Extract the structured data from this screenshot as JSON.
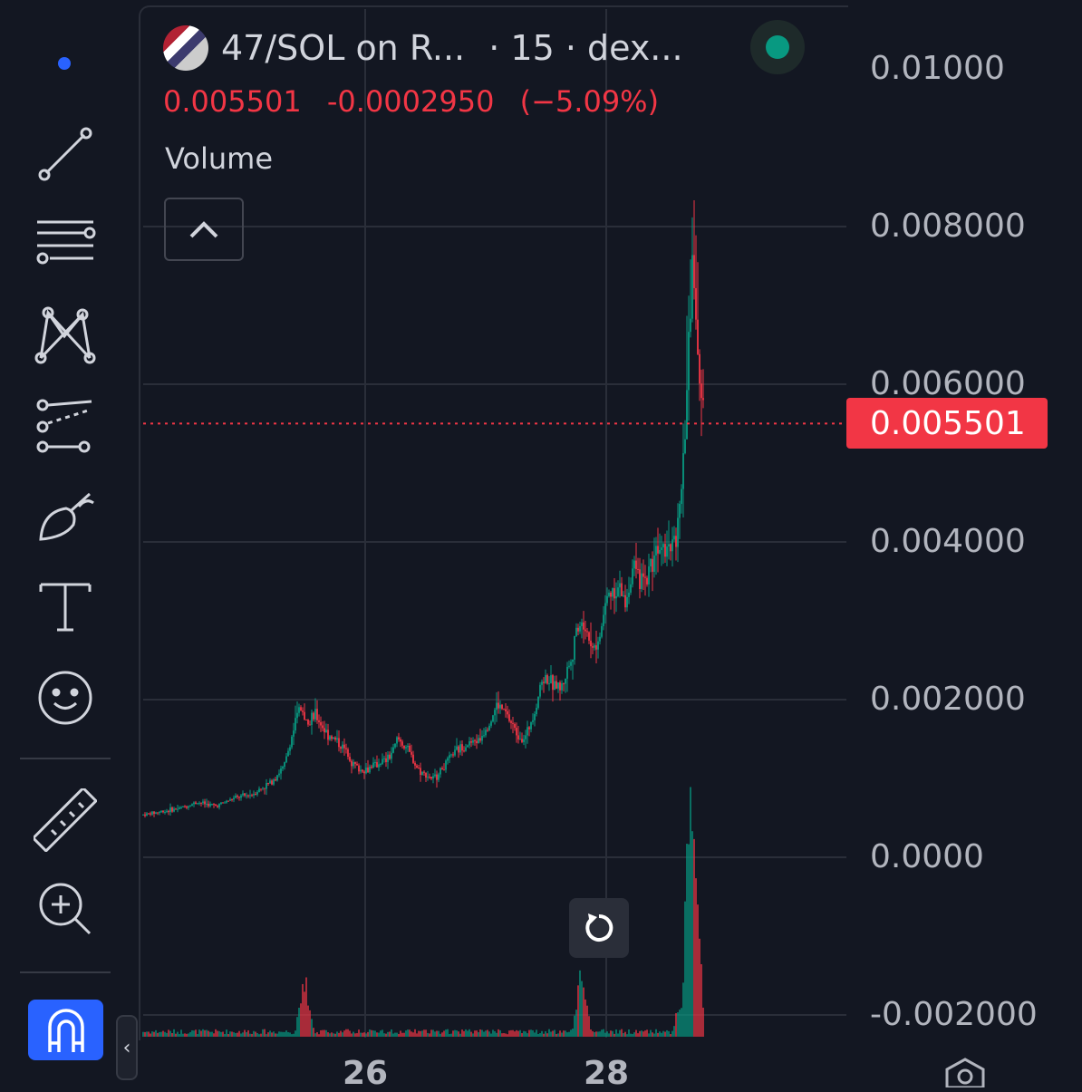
{
  "header": {
    "symbol": "47/SOL on R...",
    "interval": "· 15 · dex...",
    "last_price": "0.005501",
    "change": "-0.0002950",
    "change_pct": "(−5.09%)"
  },
  "indicator": {
    "volume_label": "Volume"
  },
  "price_axis": {
    "labels": [
      "0.01000",
      "0.008000",
      "0.006000",
      "0.004000",
      "0.002000",
      "0.0000",
      "-0.002000"
    ],
    "current_price_tag": "0.005501"
  },
  "time_axis": {
    "labels": [
      "26",
      "28"
    ]
  },
  "colors": {
    "up": "#089981",
    "down": "#f23645",
    "background": "#131722",
    "accent": "#2962ff"
  },
  "toolbar": {
    "icons": [
      "trend-line-icon",
      "horizontal-lines-icon",
      "pattern-icon",
      "forecast-icon",
      "brush-icon",
      "text-icon",
      "emoji-icon",
      "ruler-icon",
      "zoom-in-icon",
      "magnet-icon"
    ]
  },
  "chart_data": {
    "type": "candlestick",
    "price_ylim": [
      -0.002,
      0.01
    ],
    "current_price": 0.005501,
    "x_ticks": [
      "26",
      "28"
    ],
    "price_series": [
      [
        0,
        0.00054
      ],
      [
        20,
        0.00058
      ],
      [
        40,
        0.00062
      ],
      [
        60,
        0.0007
      ],
      [
        80,
        0.00065
      ],
      [
        100,
        0.00075
      ],
      [
        120,
        0.0008
      ],
      [
        140,
        0.00095
      ],
      [
        155,
        0.00115
      ],
      [
        165,
        0.0016
      ],
      [
        172,
        0.0019
      ],
      [
        180,
        0.0017
      ],
      [
        190,
        0.0018
      ],
      [
        200,
        0.0016
      ],
      [
        210,
        0.0015
      ],
      [
        220,
        0.0014
      ],
      [
        230,
        0.0012
      ],
      [
        240,
        0.0011
      ],
      [
        250,
        0.00115
      ],
      [
        260,
        0.0012
      ],
      [
        270,
        0.00125
      ],
      [
        280,
        0.0015
      ],
      [
        290,
        0.0014
      ],
      [
        300,
        0.00115
      ],
      [
        310,
        0.00105
      ],
      [
        320,
        0.001
      ],
      [
        330,
        0.00115
      ],
      [
        340,
        0.0013
      ],
      [
        350,
        0.0014
      ],
      [
        360,
        0.00145
      ],
      [
        370,
        0.0015
      ],
      [
        380,
        0.0017
      ],
      [
        390,
        0.00195
      ],
      [
        400,
        0.0018
      ],
      [
        410,
        0.0016
      ],
      [
        420,
        0.0015
      ],
      [
        430,
        0.00185
      ],
      [
        440,
        0.0023
      ],
      [
        450,
        0.0022
      ],
      [
        460,
        0.00215
      ],
      [
        470,
        0.0025
      ],
      [
        480,
        0.003
      ],
      [
        490,
        0.0028
      ],
      [
        500,
        0.00265
      ],
      [
        510,
        0.0033
      ],
      [
        520,
        0.00345
      ],
      [
        530,
        0.00325
      ],
      [
        540,
        0.0037
      ],
      [
        550,
        0.0034
      ],
      [
        560,
        0.0038
      ],
      [
        570,
        0.0041
      ],
      [
        580,
        0.00395
      ],
      [
        590,
        0.0043
      ],
      [
        595,
        0.005
      ],
      [
        600,
        0.0065
      ],
      [
        605,
        0.0078
      ],
      [
        608,
        0.007
      ],
      [
        611,
        0.0061
      ],
      [
        614,
        0.0056
      ],
      [
        616,
        0.0055
      ]
    ],
    "volume_spikes": [
      [
        175,
        0.45
      ],
      [
        180,
        0.35
      ],
      [
        480,
        0.55
      ],
      [
        485,
        0.4
      ],
      [
        590,
        0.28
      ],
      [
        600,
        2.0
      ],
      [
        605,
        1.4
      ],
      [
        612,
        0.9
      ]
    ]
  }
}
